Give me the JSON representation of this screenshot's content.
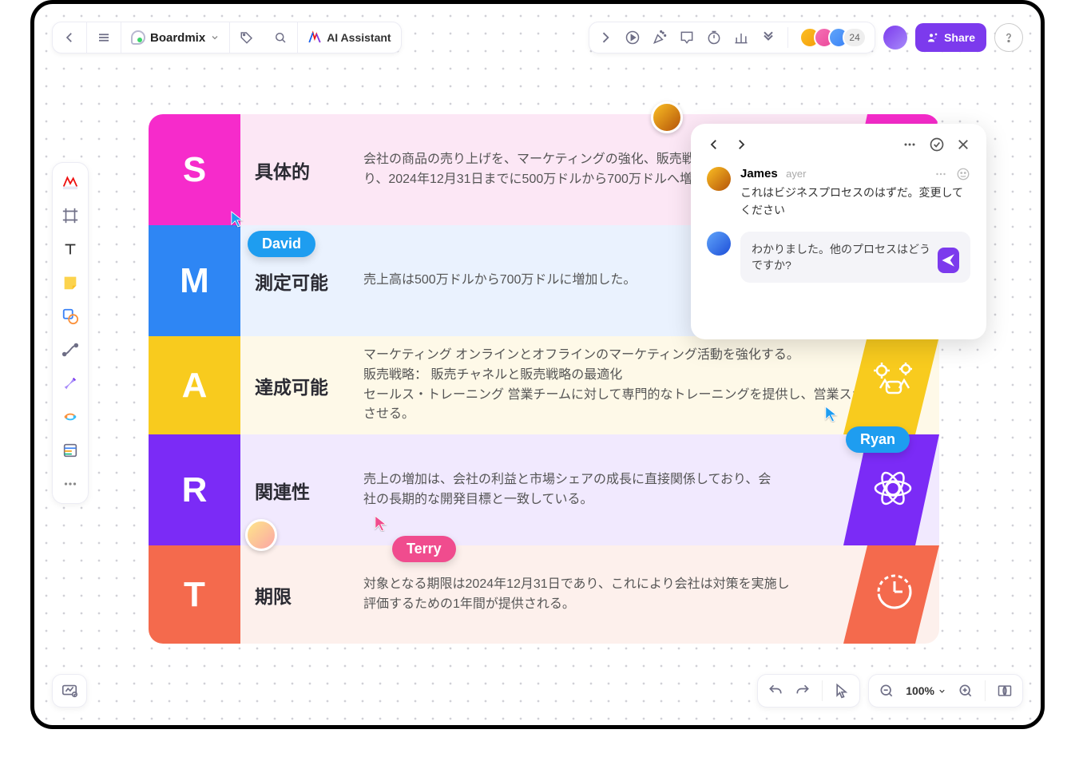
{
  "header": {
    "title": "Boardmix",
    "ai_label": "AI Assistant",
    "avatar_count": "24",
    "share_label": "Share"
  },
  "smart": {
    "rows": [
      {
        "letter": "S",
        "label": "具体的",
        "desc": "会社の商品の売り上げを、マーケティングの強化、販売戦略の最適化、販売チームの訓練により、2024年12月31日までに500万ドルから700万ドルへ増加させる。"
      },
      {
        "letter": "M",
        "label": "測定可能",
        "desc": "売上高は500万ドルから700万ドルに増加した。"
      },
      {
        "letter": "A",
        "label": "達成可能",
        "desc": "マーケティング オンラインとオフラインのマーケティング活動を強化する。\n販売戦略： 販売チャネルと販売戦略の最適化\nセールス・トレーニング 営業チームに対して専門的なトレーニングを提供し、営業スキルを向上させる。"
      },
      {
        "letter": "R",
        "label": "関連性",
        "desc": "売上の増加は、会社の利益と市場シェアの成長に直接関係しており、会社の長期的な開発目標と一致している。"
      },
      {
        "letter": "T",
        "label": "期限",
        "desc": "対象となる期限は2024年12月31日であり、これにより会社は対策を実施し評価するための1年間が提供される。"
      }
    ]
  },
  "cursors": {
    "david": "David",
    "ryan": "Ryan",
    "terry": "Terry"
  },
  "comment": {
    "author": "James",
    "time": "ayer",
    "body": "これはビジネスプロセスのはずだ。変更してください",
    "reply_draft": "わかりました。他のプロセスはどうですか?"
  },
  "bottom": {
    "zoom": "100%"
  }
}
